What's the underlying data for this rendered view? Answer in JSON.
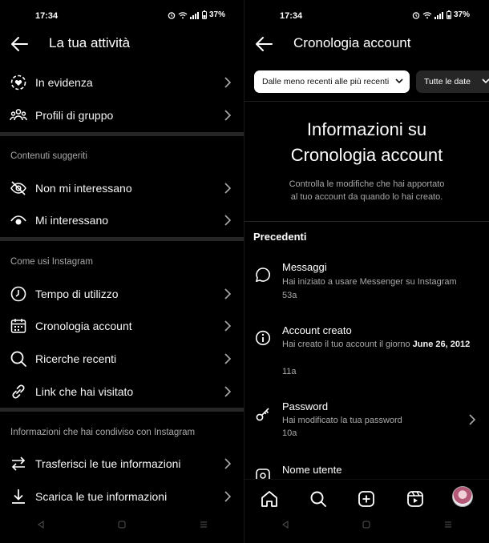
{
  "status_bar": {
    "time": "17:34",
    "battery": "37%"
  },
  "left": {
    "title": "La tua attività",
    "items_top": [
      {
        "label": "In evidenza",
        "icon": "heart-circle-icon"
      },
      {
        "label": "Profili di gruppo",
        "icon": "group-icon"
      }
    ],
    "section_suggested": "Contenuti suggeriti",
    "items_suggested": [
      {
        "label": "Non mi interessano",
        "icon": "eye-off-icon"
      },
      {
        "label": "Mi interessano",
        "icon": "eye-icon"
      }
    ],
    "section_usage": "Come usi Instagram",
    "items_usage": [
      {
        "label": "Tempo di utilizzo",
        "icon": "clock-icon"
      },
      {
        "label": "Cronologia account",
        "icon": "calendar-icon"
      },
      {
        "label": "Ricerche recenti",
        "icon": "search-icon"
      },
      {
        "label": "Link che hai visitato",
        "icon": "link-icon"
      }
    ],
    "section_shared": "Informazioni che hai condiviso con Instagram",
    "items_shared": [
      {
        "label": "Trasferisci le tue informazioni",
        "icon": "transfer-icon"
      },
      {
        "label": "Scarica le tue informazioni",
        "icon": "download-icon"
      }
    ]
  },
  "right": {
    "title": "Cronologia account",
    "filter_sort": "Dalle meno recenti alle più recenti",
    "filter_date": "Tutte le date",
    "info_title_line1": "Informazioni su",
    "info_title_line2": "Cronologia account",
    "info_sub_line1": "Controlla le modifiche che hai apportato",
    "info_sub_line2": "al tuo account da quando lo hai creato.",
    "section": "Precedenti",
    "entries": [
      {
        "title": "Messaggi",
        "desc": "Hai iniziato a usare Messenger su Instagram",
        "time": "53a",
        "icon": "message-bubble-icon"
      },
      {
        "title": "Account creato",
        "desc_prefix": "Hai creato il tuo account il giorno ",
        "desc_bold": "June 26, 2012",
        "time": "11a",
        "icon": "info-icon"
      },
      {
        "title": "Password",
        "desc": "Hai modificato la tua password",
        "time": "10a",
        "icon": "key-icon"
      },
      {
        "title": "Nome utente",
        "icon": "username-icon"
      }
    ]
  }
}
